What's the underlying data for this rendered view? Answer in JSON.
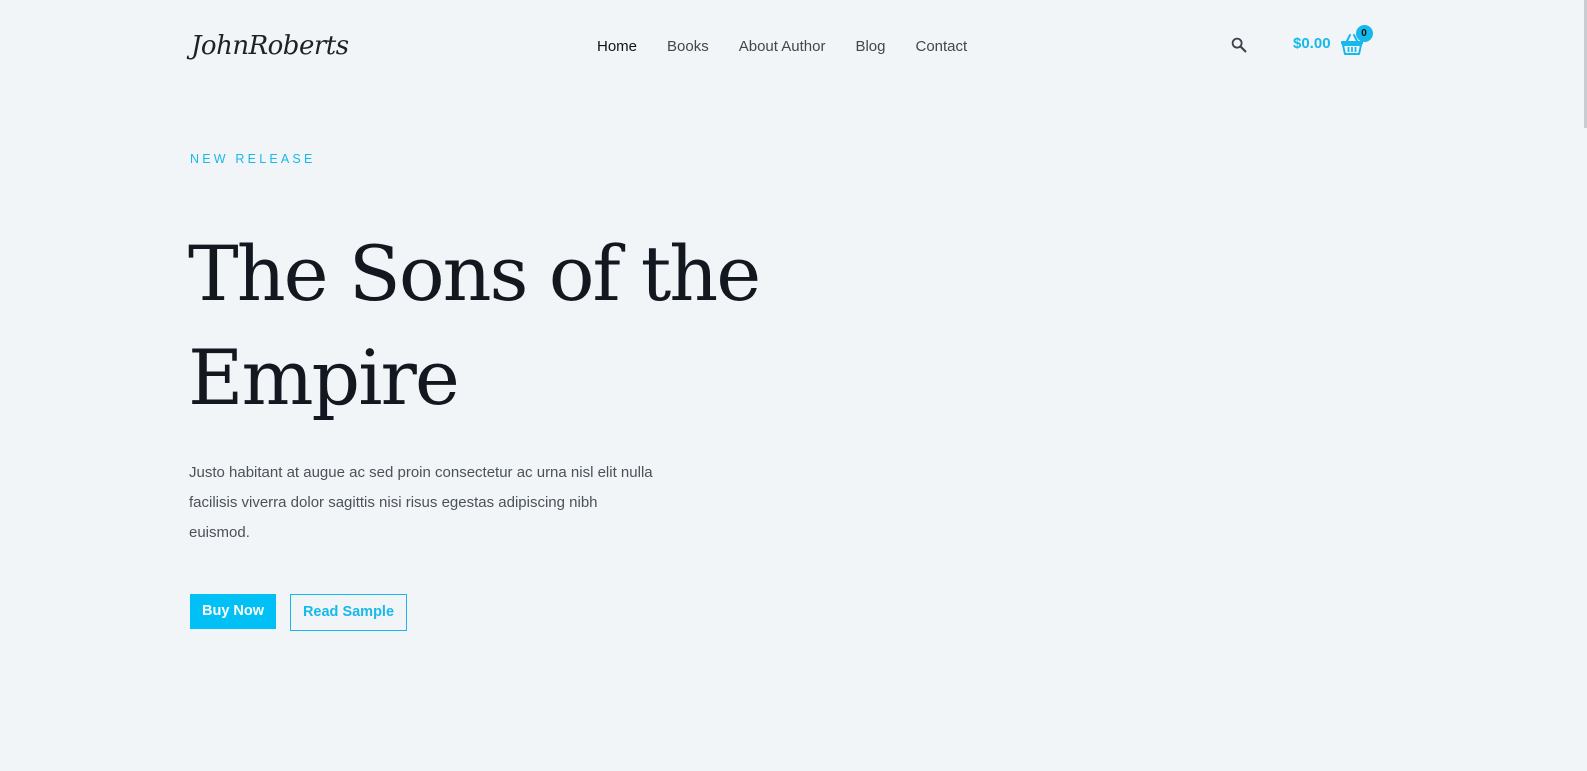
{
  "header": {
    "logo_text": "JohnRoberts",
    "nav": [
      {
        "label": "Home",
        "active": true
      },
      {
        "label": "Books",
        "active": false
      },
      {
        "label": "About Author",
        "active": false
      },
      {
        "label": "Blog",
        "active": false
      },
      {
        "label": "Contact",
        "active": false
      }
    ],
    "search_icon": "search-icon",
    "cart": {
      "total": "$0.00",
      "count": "0",
      "icon": "basket-icon"
    }
  },
  "hero": {
    "eyebrow": "NEW RELEASE",
    "title_line1": "The Sons of the",
    "title_line2": "Empire",
    "description": "Justo habitant at augue ac sed proin consectetur ac urna nisl elit nulla facilisis viverra dolor sagittis nisi risus egestas adipiscing nibh euismod.",
    "primary_button": "Buy Now",
    "secondary_button": "Read Sample"
  },
  "colors": {
    "accent": "#17b8ec",
    "button": "#00c0f5",
    "background": "#f2f5f7",
    "heading": "#131820",
    "body_text": "#4a5259"
  }
}
